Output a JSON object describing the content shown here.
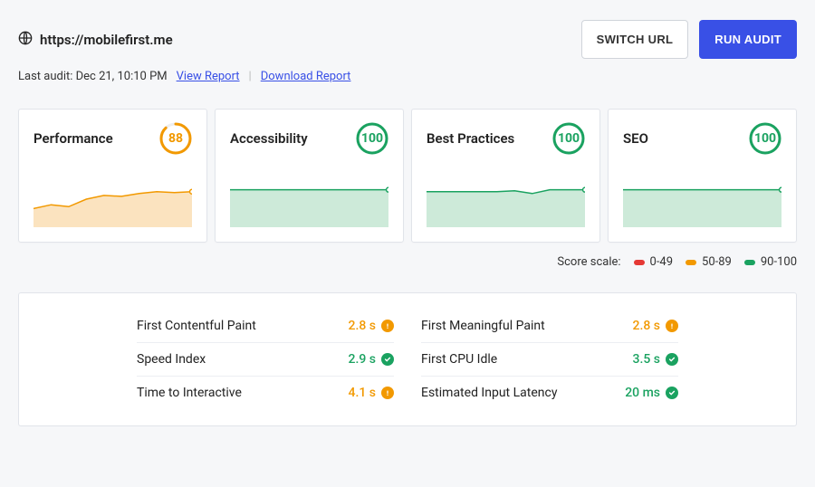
{
  "header": {
    "url": "https://mobilefirst.me",
    "switch_label": "SWITCH URL",
    "run_label": "RUN AUDIT",
    "last_audit_label": "Last audit: Dec 21, 10:10 PM",
    "view_report": "View Report",
    "download_report": "Download Report"
  },
  "colors": {
    "orange": "#f29900",
    "green": "#1aa260",
    "red": "#e53935",
    "area_orange": "#fbe3bf",
    "area_green": "#cdead9"
  },
  "cards": [
    {
      "title": "Performance",
      "score": 88,
      "color": "orange",
      "spark": [
        20,
        24,
        22,
        30,
        34,
        33,
        36,
        38,
        37,
        38
      ]
    },
    {
      "title": "Accessibility",
      "score": 100,
      "color": "green",
      "spark": [
        40,
        40,
        40,
        40,
        40,
        40,
        40,
        40,
        40,
        40
      ]
    },
    {
      "title": "Best Practices",
      "score": 100,
      "color": "green",
      "spark": [
        38,
        38,
        38,
        38,
        38,
        39,
        36,
        40,
        40,
        40
      ]
    },
    {
      "title": "SEO",
      "score": 100,
      "color": "green",
      "spark": [
        40,
        40,
        40,
        40,
        40,
        40,
        40,
        40,
        40,
        40
      ]
    }
  ],
  "scale": {
    "label": "Score scale:",
    "items": [
      {
        "color": "red",
        "text": "0-49"
      },
      {
        "color": "orange",
        "text": "50-89"
      },
      {
        "color": "green",
        "text": "90-100"
      }
    ]
  },
  "metrics": [
    {
      "name": "First Contentful Paint",
      "value": "2.8 s",
      "status": "orange"
    },
    {
      "name": "First Meaningful Paint",
      "value": "2.8 s",
      "status": "orange"
    },
    {
      "name": "Speed Index",
      "value": "2.9 s",
      "status": "green"
    },
    {
      "name": "First CPU Idle",
      "value": "3.5 s",
      "status": "green"
    },
    {
      "name": "Time to Interactive",
      "value": "4.1 s",
      "status": "orange"
    },
    {
      "name": "Estimated Input Latency",
      "value": "20 ms",
      "status": "green"
    }
  ],
  "chart_data": [
    {
      "type": "area",
      "title": "Performance",
      "x": [
        1,
        2,
        3,
        4,
        5,
        6,
        7,
        8,
        9,
        10
      ],
      "values": [
        20,
        24,
        22,
        30,
        34,
        33,
        36,
        38,
        37,
        38
      ],
      "ylim": [
        0,
        60
      ]
    },
    {
      "type": "area",
      "title": "Accessibility",
      "x": [
        1,
        2,
        3,
        4,
        5,
        6,
        7,
        8,
        9,
        10
      ],
      "values": [
        40,
        40,
        40,
        40,
        40,
        40,
        40,
        40,
        40,
        40
      ],
      "ylim": [
        0,
        60
      ]
    },
    {
      "type": "area",
      "title": "Best Practices",
      "x": [
        1,
        2,
        3,
        4,
        5,
        6,
        7,
        8,
        9,
        10
      ],
      "values": [
        38,
        38,
        38,
        38,
        38,
        39,
        36,
        40,
        40,
        40
      ],
      "ylim": [
        0,
        60
      ]
    },
    {
      "type": "area",
      "title": "SEO",
      "x": [
        1,
        2,
        3,
        4,
        5,
        6,
        7,
        8,
        9,
        10
      ],
      "values": [
        40,
        40,
        40,
        40,
        40,
        40,
        40,
        40,
        40,
        40
      ],
      "ylim": [
        0,
        60
      ]
    }
  ]
}
